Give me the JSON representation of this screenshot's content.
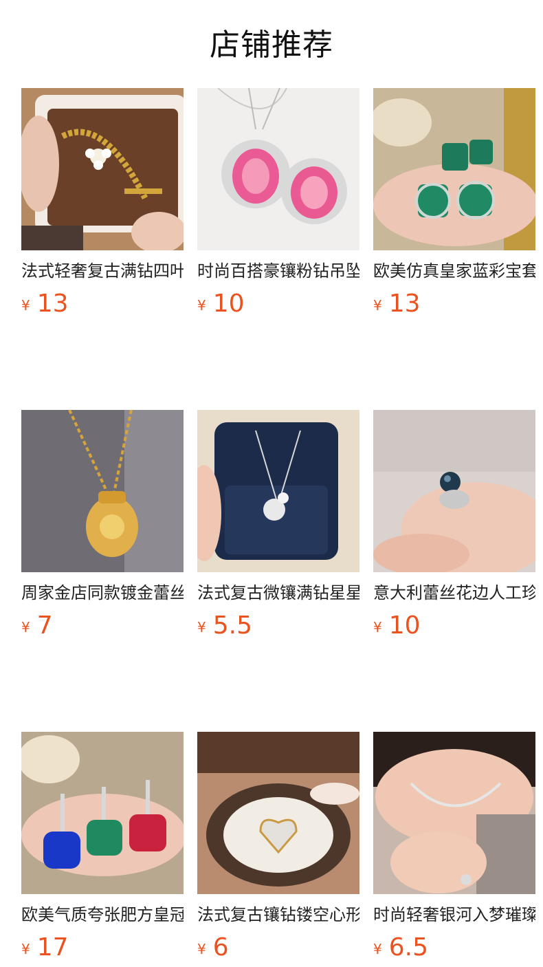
{
  "header": {
    "title": "店铺推荐"
  },
  "currency": "¥",
  "products": [
    {
      "title": "法式轻奢复古满钻四叶草手镯",
      "price": "13",
      "image": "gold-bracelet-photo"
    },
    {
      "title": "时尚百搭豪镶粉钻吊坠项链",
      "price": "10",
      "image": "pink-gem-pendant-photo"
    },
    {
      "title": "欧美仿真皇家蓝彩宝套装",
      "price": "13",
      "image": "emerald-set-photo"
    },
    {
      "title": "周家金店同款镀金蕾丝福袋项链",
      "price": "7",
      "image": "gold-pouch-necklace-photo"
    },
    {
      "title": "法式复古微镶满钻星星项链",
      "price": "5.5",
      "image": "silver-necklace-box-photo"
    },
    {
      "title": "意大利蕾丝花边人工珍珠戒指",
      "price": "10",
      "image": "pearl-ring-photo"
    },
    {
      "title": "欧美气质夸张肥方皇冠吊坠",
      "price": "17",
      "image": "colored-gem-pendants-photo"
    },
    {
      "title": "法式复古镶钻镂空心形戒指",
      "price": "6",
      "image": "heart-ring-box-photo"
    },
    {
      "title": "时尚轻奢银河入梦璀璨项链",
      "price": "6.5",
      "image": "silver-necklace-model-photo"
    }
  ],
  "colors": {
    "accent": "#e9531f",
    "title": "#222222"
  }
}
